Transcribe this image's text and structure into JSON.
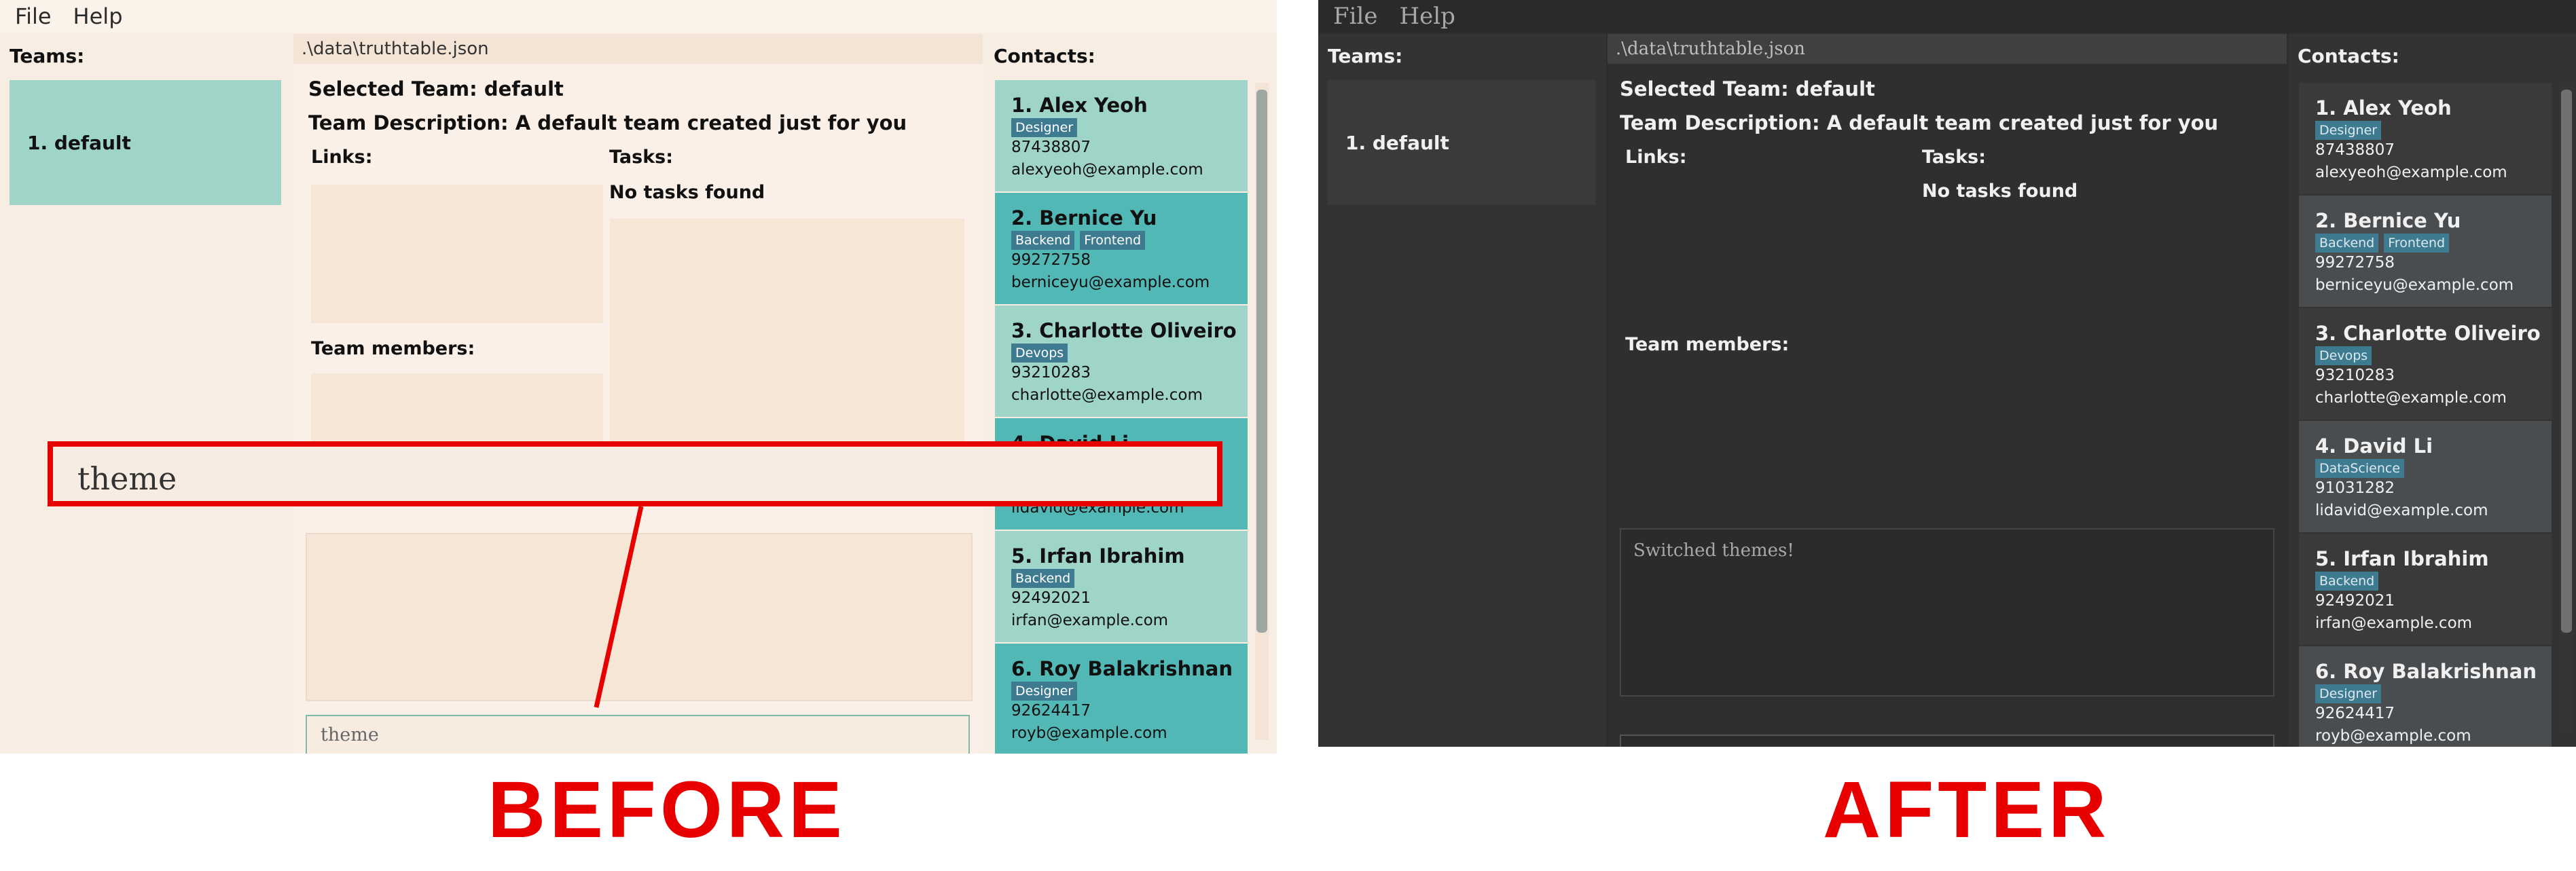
{
  "menu": [
    "File",
    "Help"
  ],
  "teams": {
    "title": "Teams:",
    "items": [
      "1. default"
    ]
  },
  "path": ".\\data\\truthtable.json",
  "selected_team": "Selected Team: default",
  "team_description": "Team Description: A default team created just for you",
  "links_label": "Links:",
  "tasks_label": "Tasks:",
  "no_tasks": "No tasks found",
  "members_label": "Team members:",
  "contacts_title": "Contacts:",
  "contacts": [
    {
      "name": "1. Alex Yeoh",
      "tags": [
        "Designer"
      ],
      "phone": "87438807",
      "email": "alexyeoh@example.com"
    },
    {
      "name": "2. Bernice Yu",
      "tags": [
        "Backend",
        "Frontend"
      ],
      "phone": "99272758",
      "email": "berniceyu@example.com"
    },
    {
      "name": "3. Charlotte Oliveiro",
      "tags": [
        "Devops"
      ],
      "phone": "93210283",
      "email": "charlotte@example.com"
    },
    {
      "name": "4. David Li",
      "tags": [
        "DataScience"
      ],
      "phone": "91031282",
      "email": "lidavid@example.com"
    },
    {
      "name": "5. Irfan Ibrahim",
      "tags": [
        "Backend"
      ],
      "phone": "92492021",
      "email": "irfan@example.com"
    },
    {
      "name": "6. Roy Balakrishnan",
      "tags": [
        "Designer"
      ],
      "phone": "92624417",
      "email": "royb@example.com"
    }
  ],
  "before": {
    "command": "theme",
    "zoom_text": "theme",
    "label": "BEFORE"
  },
  "after": {
    "result": "Switched themes!",
    "label": "AFTER"
  },
  "colors": {
    "accent_red": "#e60000",
    "light_bg": "#f7ede3",
    "dark_bg": "#2d2d2d",
    "teal": "#9fd4c8",
    "teal_dark": "#52b8b6",
    "tag": "#3e7b91"
  }
}
